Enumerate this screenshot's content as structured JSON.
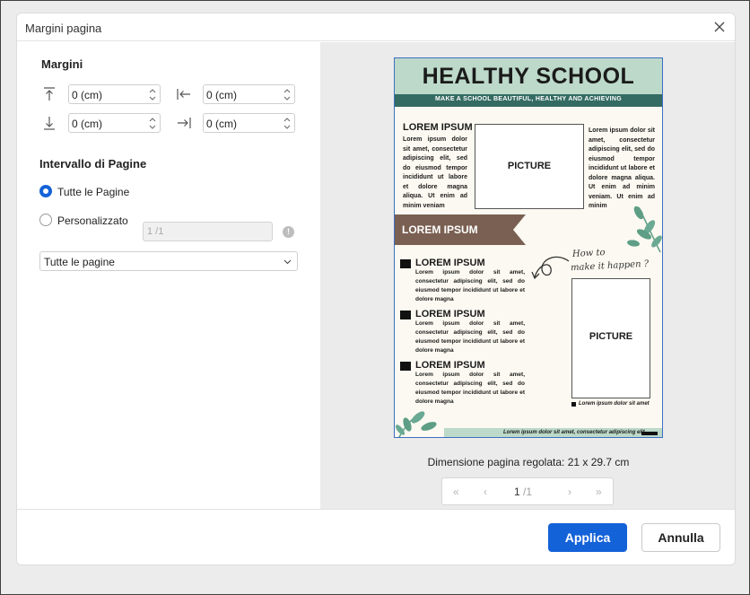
{
  "dialog": {
    "title": "Margini pagina",
    "close_icon": "close-icon"
  },
  "margins": {
    "heading": "Margini",
    "top": {
      "value": "0 (cm)",
      "icon": "margin-top-icon"
    },
    "bottom": {
      "value": "0 (cm)",
      "icon": "margin-bottom-icon"
    },
    "left": {
      "value": "0 (cm)",
      "icon": "margin-left-icon"
    },
    "right": {
      "value": "0 (cm)",
      "icon": "margin-right-icon"
    }
  },
  "page_range": {
    "heading": "Intervallo di Pagine",
    "all_label": "Tutte le Pagine",
    "custom_label": "Personalizzato",
    "custom_placeholder": "1 /1",
    "selected": "all",
    "subset_value": "Tutte le pagine"
  },
  "preview": {
    "title": "HEALTHY SCHOOL",
    "subtitle": "MAKE A SCHOOL BEAUTIFUL, HEALTHY AND ACHIEVING",
    "heading_1": "LOREM IPSUM",
    "text_left": "Lorem ipsum dolor sit amet, consectetur adipiscing elit, sed do eiusmod tempor incididunt ut labore et dolore magna aliqua. Ut enim ad minim veniam",
    "picture_label": "PICTURE",
    "text_right": "Lorem ipsum dolor sit amet, consectetur adipiscing elit, sed do eiusmod tempor incididunt ut labore et dolore magna aliqua. Ut enim ad minim veniam. Ut enim ad minim",
    "ribbon_label": "LOREM IPSUM",
    "script_line_1": "How to",
    "script_line_2": "make it happen ?",
    "list_items": [
      {
        "title": "LOREM IPSUM",
        "text": "Lorem ipsum dolor sit amet, consectetur adipiscing elit, sed do eiusmod tempor incididunt ut labore et dolore magna"
      },
      {
        "title": "LOREM IPSUM",
        "text": "Lorem ipsum dolor sit amet, consectetur adipiscing elit, sed do eiusmod tempor incididunt ut labore et dolore magna"
      },
      {
        "title": "LOREM IPSUM",
        "text": "Lorem ipsum dolor sit amet, consectetur adipiscing elit, sed do eiusmod tempor incididunt ut labore et dolore magna"
      }
    ],
    "picture_2_label": "PICTURE",
    "caption": "Lorem ipsum dolor sit amet",
    "footer_text": "Lorem ipsum dolor sit amet, consectetur adipiscing elit"
  },
  "page_info": {
    "dimension": "Dimensione pagina regolata: 21 x 29.7 cm"
  },
  "pager": {
    "first": "«",
    "prev": "‹",
    "current": "1",
    "total": "/1",
    "next": "›",
    "last": "»"
  },
  "buttons": {
    "apply": "Applica",
    "cancel": "Annulla"
  },
  "colors": {
    "accent": "#1462d8",
    "header_green": "#bcd9c9",
    "band_teal": "#346b62",
    "ribbon_brown": "#7a6052",
    "leaf_green": "#5e9e86"
  }
}
